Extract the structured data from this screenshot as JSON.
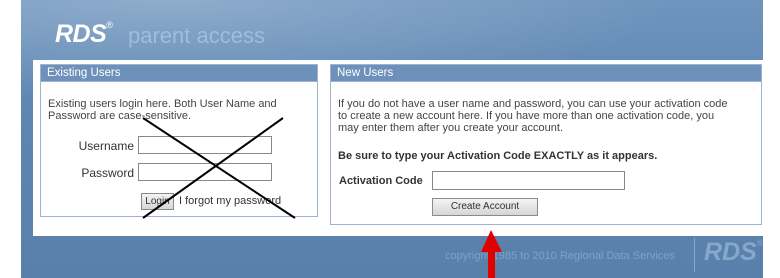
{
  "header": {
    "logo": "RDS",
    "logo_mark": "®",
    "title": "parent access"
  },
  "existing_users": {
    "heading": "Existing Users",
    "intro_line1": "Existing users login here. Both User Name and",
    "intro_line2": "Password are case-sensitive.",
    "username_label": "Username",
    "password_label": "Password",
    "login_button": "Login",
    "forgot_link": "I forgot my password"
  },
  "new_users": {
    "heading": "New Users",
    "intro_line1": "If you do not have a user name and password, you can use your activation code",
    "intro_line2": "to create a new account here. If you have more than one activation code, you",
    "intro_line3": "may enter them after you create your account.",
    "notice": "Be sure to type your Activation Code EXACTLY as it appears.",
    "activation_label": "Activation Code",
    "create_button": "Create Account"
  },
  "footer": {
    "copyright": "copyright 1985 to 2010 Regional Data Services",
    "logo": "RDS",
    "logo_mark": "®"
  },
  "annotations": {
    "x_mark_color": "#000000",
    "arrow_color": "#e00000",
    "x_mark_icon": "cross-out-mark",
    "arrow_icon": "red-up-arrow"
  }
}
